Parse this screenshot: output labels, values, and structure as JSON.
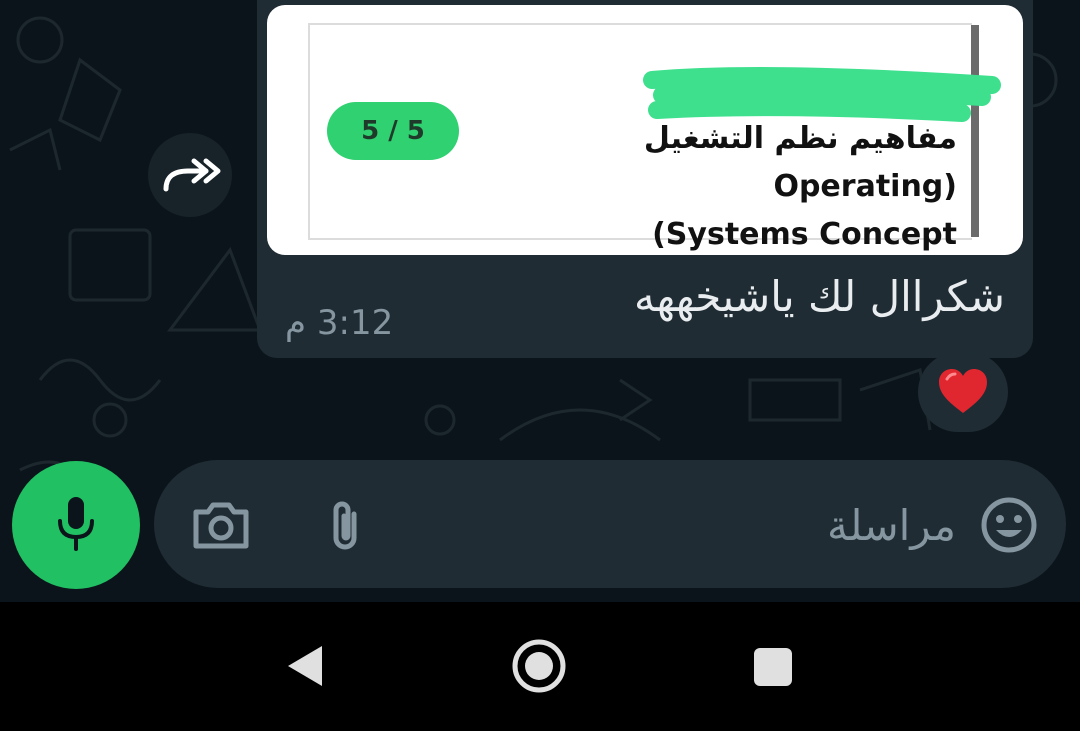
{
  "message": {
    "quoted_document": {
      "page_indicator": "5 / 5",
      "title": "مفاهيم نظم التشغيل (Operating\nSystems Concept)"
    },
    "text": "شكراال لك ياشيخههه",
    "time": "3:12 م",
    "reaction": "heart-emoji"
  },
  "composer": {
    "placeholder": "مراسلة"
  },
  "colors": {
    "background": "#0b141a",
    "bubble": "#1f2c34",
    "accent_green": "#21c063",
    "page_pill": "#2fd170",
    "scribble": "#3ee08e"
  },
  "icons": [
    "forward-icon",
    "heart-icon",
    "mic-icon",
    "emoji-icon",
    "attach-icon",
    "camera-icon",
    "back-icon",
    "home-icon",
    "recents-icon"
  ]
}
